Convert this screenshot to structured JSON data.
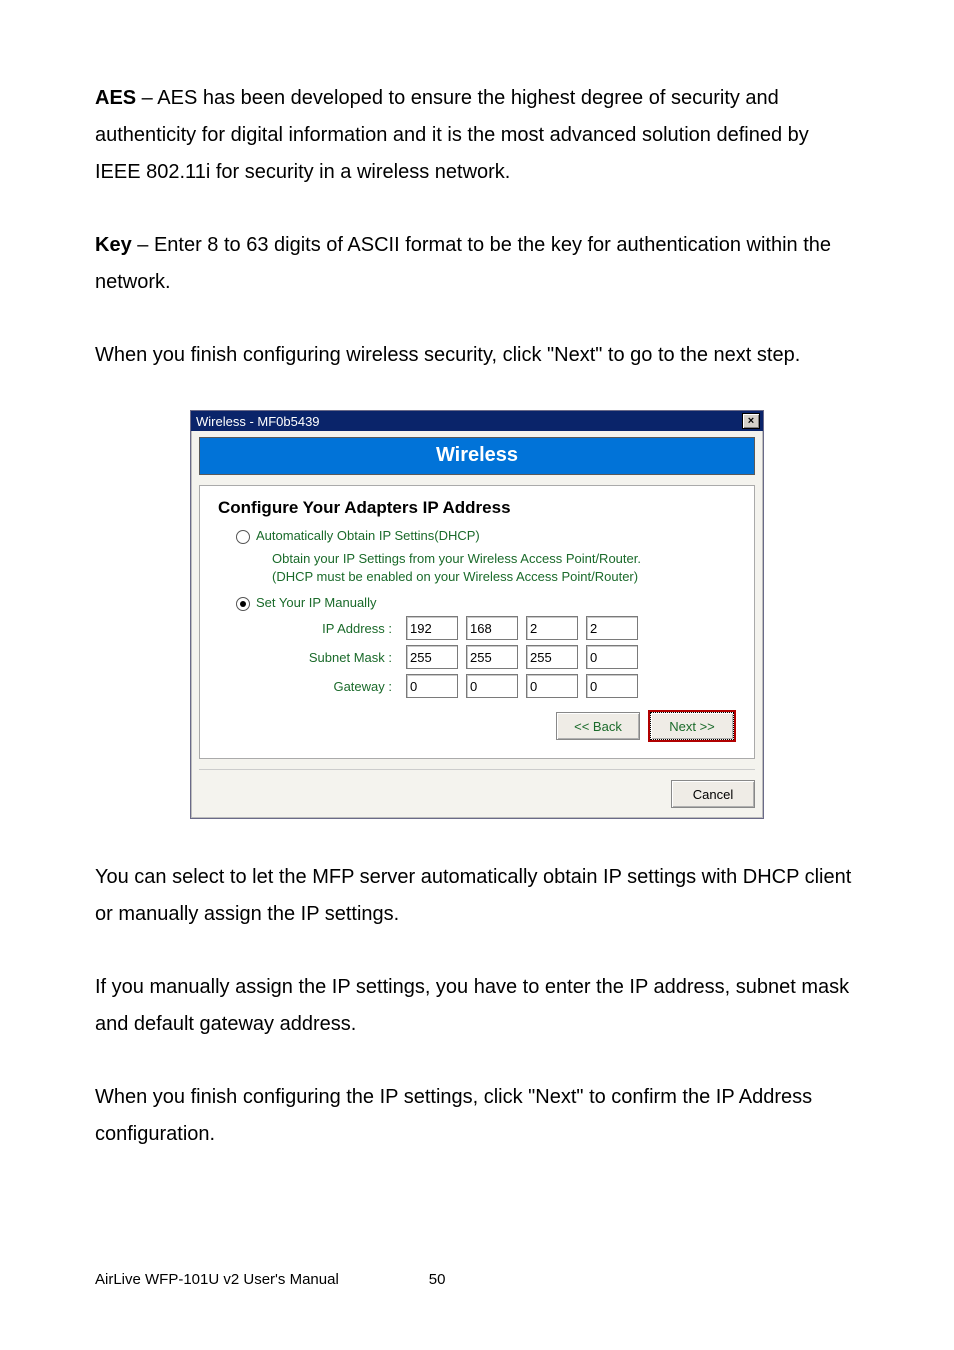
{
  "para1": {
    "label": "AES",
    "text": " – AES has been developed to ensure the highest degree of security and authenticity for digital information and it is the most advanced solution defined by IEEE 802.11i for security in a wireless network."
  },
  "para2": {
    "label": "Key",
    "text": " – Enter 8 to 63 digits of ASCII format to be the key for authentication within the network."
  },
  "para3": "When you finish configuring wireless security, click \"Next\" to go to the next step.",
  "dialog": {
    "title": "Wireless - MF0b5439",
    "banner": "Wireless",
    "group_title": "Configure Your Adapters IP Address",
    "radio_dhcp": "Automatically Obtain IP Settins(DHCP)",
    "hint1": "Obtain your IP Settings from your Wireless Access Point/Router.",
    "hint2": "(DHCP must be enabled on your Wireless Access Point/Router)",
    "radio_manual": "Set Your IP Manually",
    "labels": {
      "ip": "IP Address :",
      "mask": "Subnet Mask :",
      "gw": "Gateway :"
    },
    "ip": [
      "192",
      "168",
      "2",
      "2"
    ],
    "mask": [
      "255",
      "255",
      "255",
      "0"
    ],
    "gw": [
      "0",
      "0",
      "0",
      "0"
    ],
    "back": "<< Back",
    "next": "Next >>",
    "cancel": "Cancel"
  },
  "para4": "You can select to let the MFP server automatically obtain IP settings with DHCP client or manually assign the IP settings.",
  "para5": "If you manually assign the IP settings, you have to enter the IP address, subnet mask and default gateway address.",
  "para6": "When you finish configuring the IP settings, click \"Next\" to confirm the IP Address configuration.",
  "footer": {
    "product": "AirLive WFP-101U v2 User's Manual",
    "page": "50"
  }
}
